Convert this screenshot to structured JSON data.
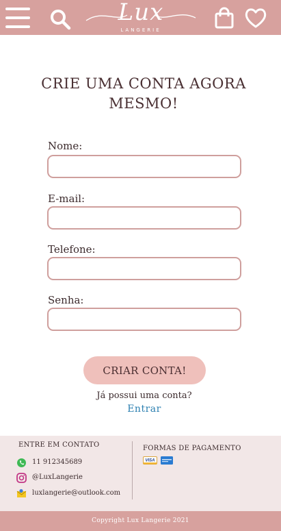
{
  "header": {
    "logo_script": "Lux",
    "logo_sub": "LANGERIE",
    "icons": [
      "menu-icon",
      "search-icon",
      "shopping-bag-icon",
      "heart-icon"
    ]
  },
  "form": {
    "title_line1": "CRIE UMA CONTA AGORA",
    "title_line2": "MESMO!",
    "fields": [
      {
        "label": "Nome:",
        "value": "",
        "placeholder": ""
      },
      {
        "label": "E-mail:",
        "value": "",
        "placeholder": ""
      },
      {
        "label": "Telefone:",
        "value": "",
        "placeholder": ""
      },
      {
        "label": "Senha:",
        "value": "",
        "placeholder": ""
      }
    ],
    "submit_label": "CRIAR CONTA!",
    "have_account": "Já possui uma conta?",
    "login_link": "Entrar"
  },
  "footer": {
    "contact_title": "ENTRE EM CONTATO",
    "contacts": [
      {
        "icon": "whatsapp-icon",
        "text": "11 912345689"
      },
      {
        "icon": "instagram-icon",
        "text": "@LuxLangerie"
      },
      {
        "icon": "email-icon",
        "text": "luxlangerie@outlook.com"
      }
    ],
    "payment_title": "FORMAS DE PAGAMENTO",
    "payment_cards": [
      {
        "icon": "visa-card-icon",
        "text": "VISA"
      },
      {
        "icon": "amex-card-icon",
        "text": ""
      }
    ],
    "copyright": "Copyright Lux Langerie 2021"
  },
  "colors": {
    "brand_pink": "#d7a19e",
    "button_pink": "#efc0bb",
    "footer_bg": "#f2e7e7",
    "link_blue": "#2b7fb0",
    "field_border": "#cf9f9d"
  }
}
